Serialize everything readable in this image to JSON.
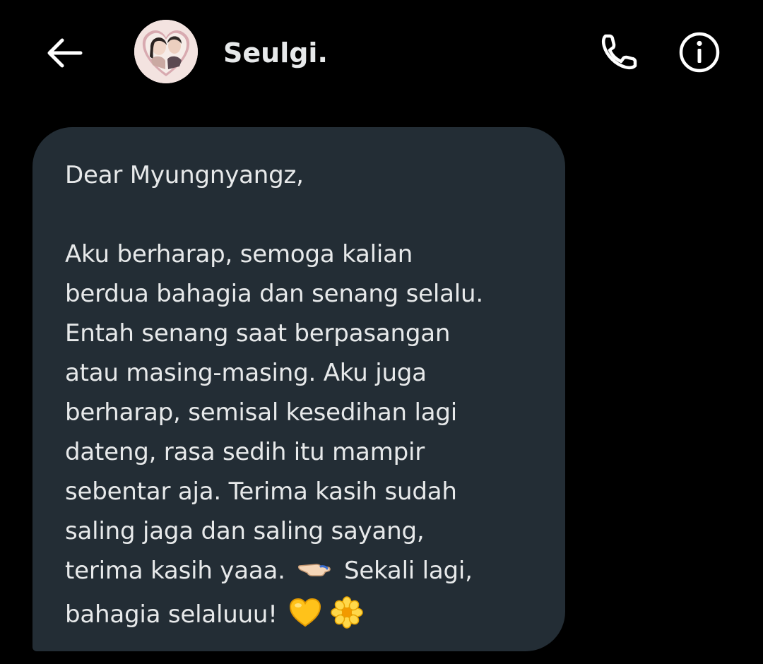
{
  "header": {
    "contact_name": "Seulgi.",
    "back_icon": "arrow-left-icon",
    "call_icon": "phone-icon",
    "info_icon": "info-icon",
    "avatar_icon": "avatar-photo"
  },
  "message": {
    "lines": [
      "Dear Myungnyangz,",
      "",
      "Aku berharap, semoga kalian",
      "berdua bahagia dan senang selalu.",
      "Entah senang saat berpasangan",
      "atau masing-masing. Aku juga",
      "berharap, semisal kesedihan lagi",
      "dateng, rasa sedih itu mampir",
      "sebentar aja. Terima kasih sudah",
      "saling jaga dan saling sayang,",
      "terima kasih yaaa.",
      "Sekali lagi,",
      "bahagia selaluuu!"
    ],
    "emoji_pointing": "pointing-left-hand-emoji",
    "emoji_heart": "yellow-heart-emoji",
    "emoji_flower": "blossom-emoji"
  },
  "colors": {
    "background": "#000000",
    "bubble": "#232d35",
    "text": "#e7e9ea"
  }
}
